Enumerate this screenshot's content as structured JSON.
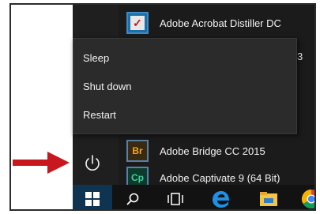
{
  "start_menu": {
    "apps": [
      {
        "label": "Adobe Acrobat Distiller DC",
        "icon": "acrobat-icon"
      },
      {
        "label": "Adobe Bridge CC 2015",
        "icon": "bridge-icon",
        "icon_text": "Br"
      },
      {
        "label": "Adobe Captivate 9 (64 Bit)",
        "icon": "captivate-icon",
        "icon_text": "Cp"
      }
    ],
    "hidden_row_fragment": "3"
  },
  "power_menu": {
    "items": [
      {
        "label": "Sleep"
      },
      {
        "label": "Shut down"
      },
      {
        "label": "Restart"
      }
    ]
  },
  "taskbar": {
    "items": [
      "windows-start-icon",
      "search-icon",
      "task-view-icon",
      "edge-icon",
      "file-explorer-icon",
      "chrome-icon"
    ]
  },
  "colors": {
    "arrow": "#c8171e",
    "menu_bg": "#2b2b2b",
    "rail_bg": "#1f1f1f",
    "taskbar_bg": "#121212",
    "start_highlight": "#0f3452"
  }
}
